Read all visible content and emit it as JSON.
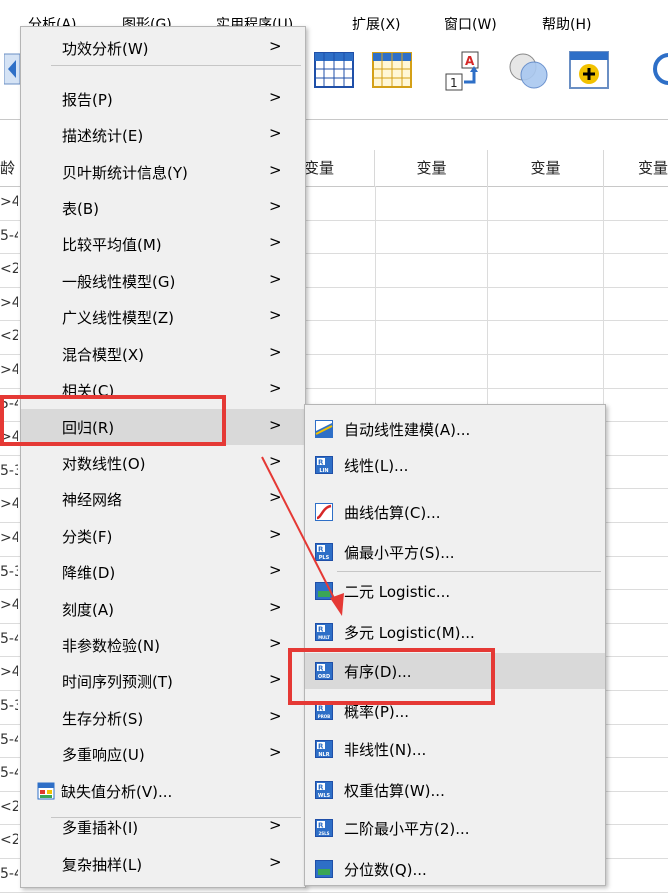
{
  "menubar": {
    "items": [
      {
        "label": "分析(A)",
        "key": "A"
      },
      {
        "label": "图形(G)",
        "key": "G"
      },
      {
        "label": "实用程序(U)",
        "key": "U"
      },
      {
        "label": "扩展(X)",
        "key": "X"
      },
      {
        "label": "窗口(W)",
        "key": "W"
      },
      {
        "label": "帮助(H)",
        "key": "H"
      }
    ]
  },
  "grid": {
    "headers": [
      "龄",
      "变量",
      "变量",
      "变量",
      "变量"
    ],
    "row_stubs": [
      ">4",
      "5-4",
      "<2",
      ">4",
      "<2",
      ">4",
      "5-4",
      ">4",
      "5-3",
      ">4",
      ">4",
      "5-3",
      ">4",
      "5-4",
      ">4",
      "5-3",
      "5-4",
      "5-4",
      "<2",
      "<2",
      "5-4"
    ]
  },
  "main_menu": {
    "items": [
      {
        "label": "功效分析(W)",
        "has_submenu": true
      },
      {
        "label": "报告(P)",
        "has_submenu": true
      },
      {
        "label": "描述统计(E)",
        "has_submenu": true
      },
      {
        "label": "贝叶斯统计信息(Y)",
        "has_submenu": true
      },
      {
        "label": "表(B)",
        "has_submenu": true
      },
      {
        "label": "比较平均值(M)",
        "has_submenu": true
      },
      {
        "label": "一般线性模型(G)",
        "has_submenu": true
      },
      {
        "label": "广义线性模型(Z)",
        "has_submenu": true
      },
      {
        "label": "混合模型(X)",
        "has_submenu": true
      },
      {
        "label": "相关(C)",
        "has_submenu": true
      },
      {
        "label": "回归(R)",
        "has_submenu": true,
        "highlighted": true
      },
      {
        "label": "对数线性(O)",
        "has_submenu": true
      },
      {
        "label": "神经网络",
        "has_submenu": true
      },
      {
        "label": "分类(F)",
        "has_submenu": true
      },
      {
        "label": "降维(D)",
        "has_submenu": true
      },
      {
        "label": "刻度(A)",
        "has_submenu": true
      },
      {
        "label": "非参数检验(N)",
        "has_submenu": true
      },
      {
        "label": "时间序列预测(T)",
        "has_submenu": true
      },
      {
        "label": "生存分析(S)",
        "has_submenu": true
      },
      {
        "label": "多重响应(U)",
        "has_submenu": true
      },
      {
        "label": "缺失值分析(V)...",
        "has_submenu": false,
        "icon": "missing-value-icon"
      },
      {
        "label": "多重插补(I)",
        "has_submenu": true
      },
      {
        "label": "复杂抽样(L)",
        "has_submenu": true
      }
    ],
    "arrow_glyph": ">"
  },
  "sub_menu": {
    "items": [
      {
        "label": "自动线性建模(A)...",
        "icon": "auto-linear-icon",
        "icon_text": ""
      },
      {
        "label": "线性(L)...",
        "icon": "linear-icon",
        "icon_text": "LIN"
      },
      {
        "label": "曲线估算(C)...",
        "icon": "curve-icon",
        "icon_text": ""
      },
      {
        "label": "偏最小平方(S)...",
        "icon": "pls-icon",
        "icon_text": "PLS"
      },
      {
        "label": "二元 Logistic...",
        "icon": "binary-logistic-icon",
        "icon_text": ""
      },
      {
        "label": "多元 Logistic(M)...",
        "icon": "multinomial-logistic-icon",
        "icon_text": "MULT"
      },
      {
        "label": "有序(D)...",
        "icon": "ordinal-icon",
        "icon_text": "ORD",
        "highlighted": true
      },
      {
        "label": "概率(P)...",
        "icon": "probit-icon",
        "icon_text": "PROB"
      },
      {
        "label": "非线性(N)...",
        "icon": "nonlinear-icon",
        "icon_text": "NLR"
      },
      {
        "label": "权重估算(W)...",
        "icon": "weight-estimation-icon",
        "icon_text": "WLS"
      },
      {
        "label": "二阶最小平方(2)...",
        "icon": "two-stage-icon",
        "icon_text": "2SLS"
      },
      {
        "label": "分位数(Q)...",
        "icon": "quantile-icon",
        "icon_text": ""
      }
    ]
  },
  "colors": {
    "annotation_red": "#e53935",
    "menu_bg": "#f0f0f0",
    "menu_highlight": "#d9d9d9",
    "icon_blue": "#2e6fc7"
  }
}
